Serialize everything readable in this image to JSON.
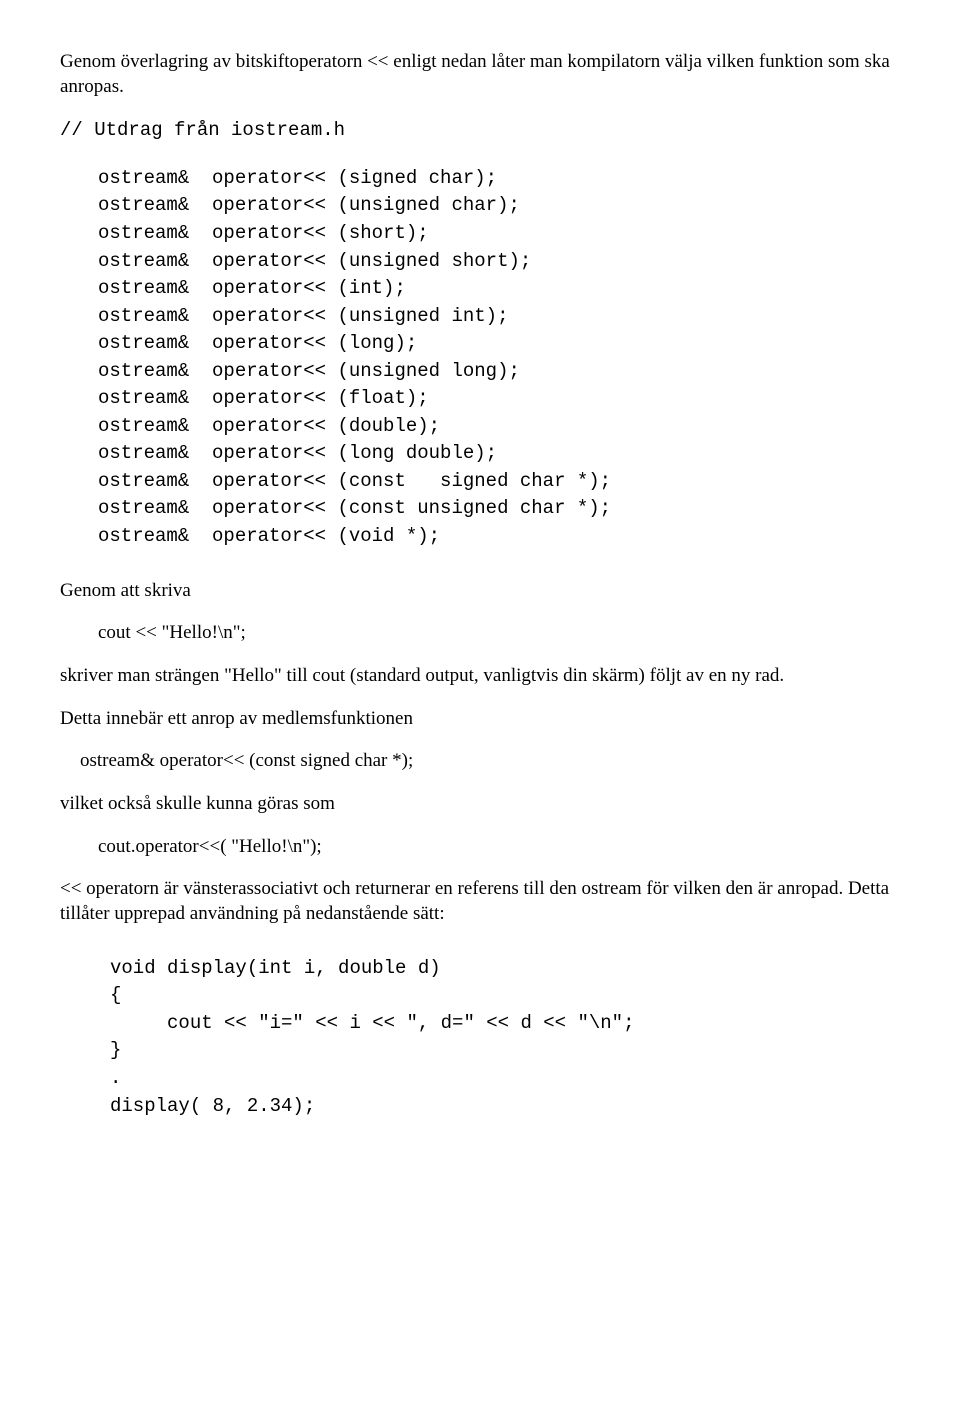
{
  "p1": "Genom överlagring av bitskiftoperatorn << enligt nedan låter man kompilatorn välja vilken funktion som ska anropas.",
  "code1_comment": "// Utdrag från iostream.h",
  "code1_body": "ostream&  operator<< (signed char);\nostream&  operator<< (unsigned char);\nostream&  operator<< (short);\nostream&  operator<< (unsigned short);\nostream&  operator<< (int);\nostream&  operator<< (unsigned int);\nostream&  operator<< (long);\nostream&  operator<< (unsigned long);\nostream&  operator<< (float);\nostream&  operator<< (double);\nostream&  operator<< (long double);\nostream&  operator<< (const   signed char *);\nostream&  operator<< (const unsigned char *);\nostream&  operator<< (void *);",
  "p2": "Genom att skriva",
  "code2": "cout << \"Hello!\\n\";",
  "p3": "skriver man strängen \"Hello\" till cout (standard output, vanligtvis din skärm) följt av en ny rad.",
  "p4": "Detta innebär ett anrop av medlemsfunktionen",
  "code3": "ostream&  operator<< (const   signed char *);",
  "p5": "vilket också skulle kunna göras som",
  "code4": "cout.operator<<( \"Hello!\\n\");",
  "p6": "<< operatorn är vänsterassociativt och returnerar en referens till den ostream för vilken den är anropad. Detta tillåter upprepad användning på nedanstående sätt:",
  "code5": "void display(int i, double d)\n{\n     cout << \"i=\" << i << \", d=\" << d << \"\\n\";\n}\n.\ndisplay( 8, 2.34);"
}
